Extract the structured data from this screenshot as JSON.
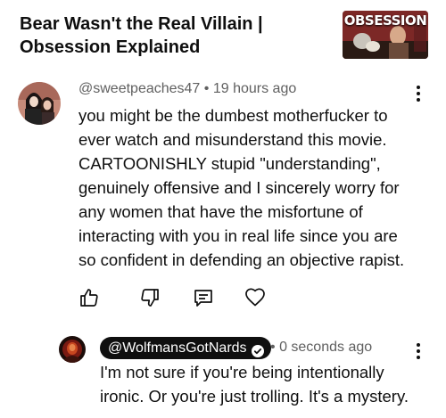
{
  "video": {
    "title": "Bear Wasn't the Real Villain | Obsession Explained",
    "thumbnail_text": "OBSESSION"
  },
  "comments": [
    {
      "author": "@sweetpeaches47",
      "timestamp": "19 hours ago",
      "text": "you might be the dumbest motherfucker to ever watch and misunderstand this movie. CARTOONISHLY stupid \"understanding\", genuinely offensive and I sincerely worry for any women that have the misfortune of interacting with you in real life since you are so confident in defending an objective rapist.",
      "actions": [
        "like-icon",
        "dislike-icon",
        "reply-icon",
        "heart-icon"
      ]
    }
  ],
  "reply": {
    "author": "@WolfmansGotNards",
    "author_verified": true,
    "timestamp": "0 seconds ago",
    "text": "I'm not sure if you're being intentionally ironic. Or you're just trolling. It's a mystery."
  },
  "separator": "•",
  "colors": {
    "text": "#0f0f0f",
    "meta": "#606060",
    "chip_bg": "#0f0f0f",
    "thumb_red": "#b3262a"
  }
}
